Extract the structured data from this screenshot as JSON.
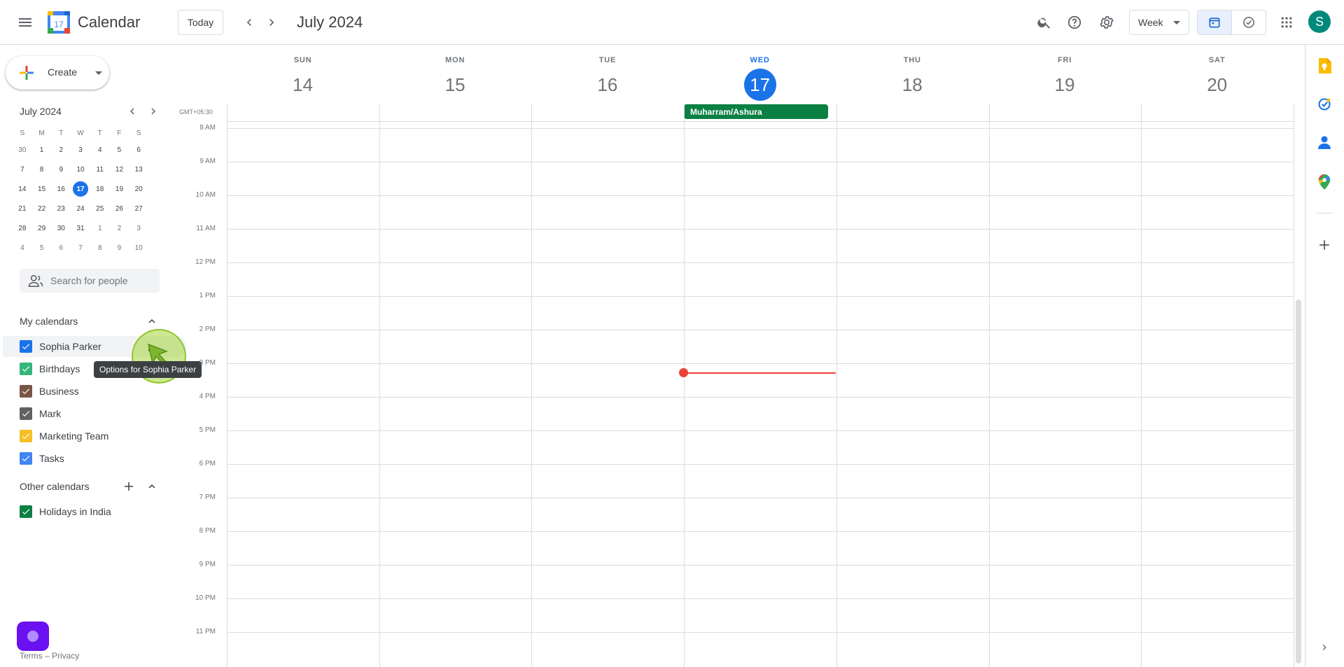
{
  "header": {
    "app_title": "Calendar",
    "logo_day": "17",
    "today_label": "Today",
    "current_range": "July 2024",
    "view_label": "Week",
    "avatar_initial": "S"
  },
  "create": {
    "label": "Create"
  },
  "mini_calendar": {
    "title": "July 2024",
    "weekdays": [
      "S",
      "M",
      "T",
      "W",
      "T",
      "F",
      "S"
    ],
    "weeks": [
      [
        "30",
        "1",
        "2",
        "3",
        "4",
        "5",
        "6"
      ],
      [
        "7",
        "8",
        "9",
        "10",
        "11",
        "12",
        "13"
      ],
      [
        "14",
        "15",
        "16",
        "17",
        "18",
        "19",
        "20"
      ],
      [
        "21",
        "22",
        "23",
        "24",
        "25",
        "26",
        "27"
      ],
      [
        "28",
        "29",
        "30",
        "31",
        "1",
        "2",
        "3"
      ],
      [
        "4",
        "5",
        "6",
        "7",
        "8",
        "9",
        "10"
      ]
    ],
    "today": "17"
  },
  "people_search": {
    "placeholder": "Search for people"
  },
  "my_calendars": {
    "title": "My calendars",
    "items": [
      {
        "label": "Sophia Parker",
        "color": "#1a73e8"
      },
      {
        "label": "Birthdays",
        "color": "#33b679"
      },
      {
        "label": "Business",
        "color": "#795548"
      },
      {
        "label": "Mark",
        "color": "#616161"
      },
      {
        "label": "Marketing Team",
        "color": "#f6bf26"
      },
      {
        "label": "Tasks",
        "color": "#4285f4"
      }
    ]
  },
  "other_calendars": {
    "title": "Other calendars",
    "items": [
      {
        "label": "Holidays in India",
        "color": "#0b8043"
      }
    ]
  },
  "tooltip": {
    "text": "Options for Sophia Parker"
  },
  "footer": {
    "text": "Terms – Privacy"
  },
  "week": {
    "timezone": "GMT+05:30",
    "days": [
      {
        "name": "SUN",
        "num": "14"
      },
      {
        "name": "MON",
        "num": "15"
      },
      {
        "name": "TUE",
        "num": "16"
      },
      {
        "name": "WED",
        "num": "17"
      },
      {
        "name": "THU",
        "num": "18"
      },
      {
        "name": "FRI",
        "num": "19"
      },
      {
        "name": "SAT",
        "num": "20"
      }
    ],
    "hours": [
      "8 AM",
      "9 AM",
      "10 AM",
      "11 AM",
      "12 PM",
      "1 PM",
      "2 PM",
      "3 PM",
      "4 PM",
      "5 PM",
      "6 PM",
      "7 PM",
      "8 PM",
      "9 PM",
      "10 PM",
      "11 PM"
    ],
    "all_day_event": {
      "title": "Muharram/Ashura",
      "color": "#0b8043"
    }
  }
}
